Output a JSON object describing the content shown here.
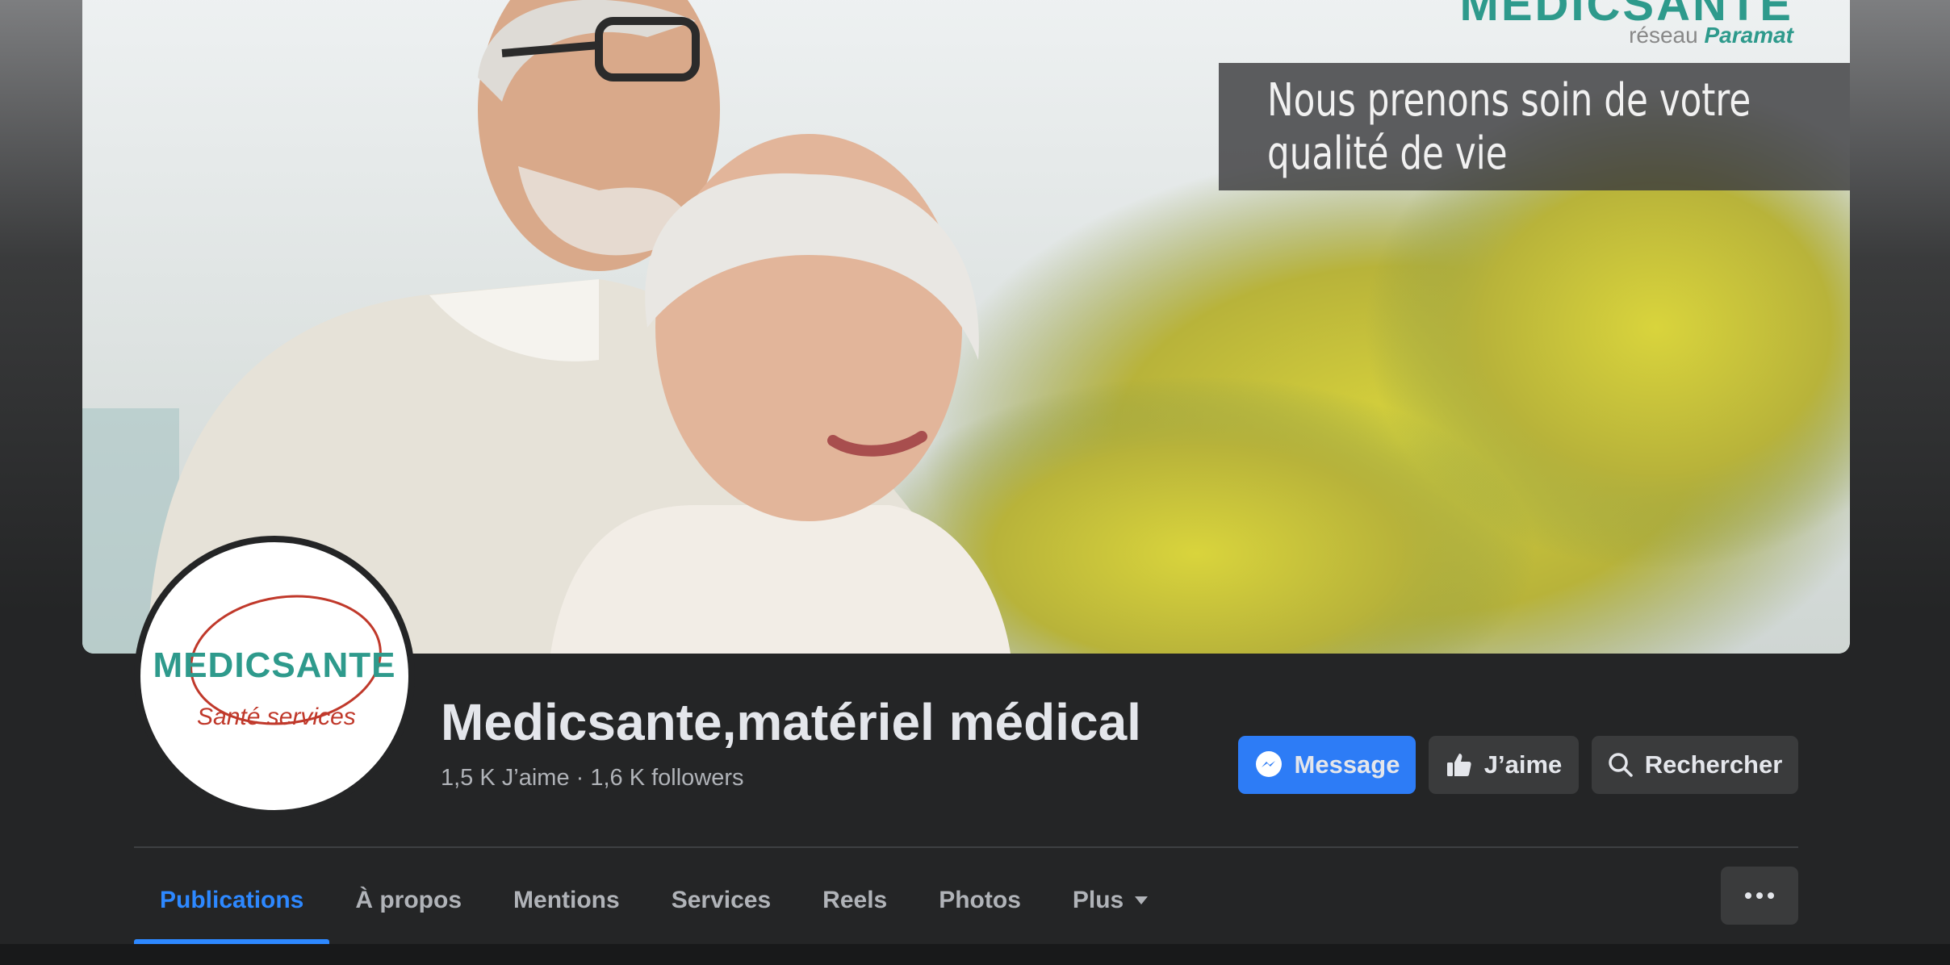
{
  "cover": {
    "brand": "MEDICSANTE",
    "network_prefix": "réseau",
    "network_name": "Paramat",
    "tagline_line1": "Nous prenons soin de votre",
    "tagline_line2": "qualité de vie"
  },
  "avatar": {
    "brand": "MEDICSANTE",
    "subtitle": "Santé services"
  },
  "page": {
    "title": "Medicsante,matériel médical",
    "stats": "1,5 K J’aime · 1,6 K followers"
  },
  "actions": {
    "message": "Message",
    "like": "J’aime",
    "search": "Rechercher"
  },
  "tabs": [
    {
      "label": "Publications",
      "active": true
    },
    {
      "label": "À propos"
    },
    {
      "label": "Mentions"
    },
    {
      "label": "Services"
    },
    {
      "label": "Reels"
    },
    {
      "label": "Photos"
    },
    {
      "label": "Plus"
    }
  ],
  "colors": {
    "accent": "#2d88ff",
    "primary_button": "#2d7cf6",
    "background": "#242526",
    "brand_teal": "#2e9a8c"
  },
  "icons": {
    "message": "messenger-icon",
    "like": "thumbs-up-icon",
    "search": "search-icon",
    "plus": "caret-down-icon",
    "more": "more-dots-icon"
  }
}
